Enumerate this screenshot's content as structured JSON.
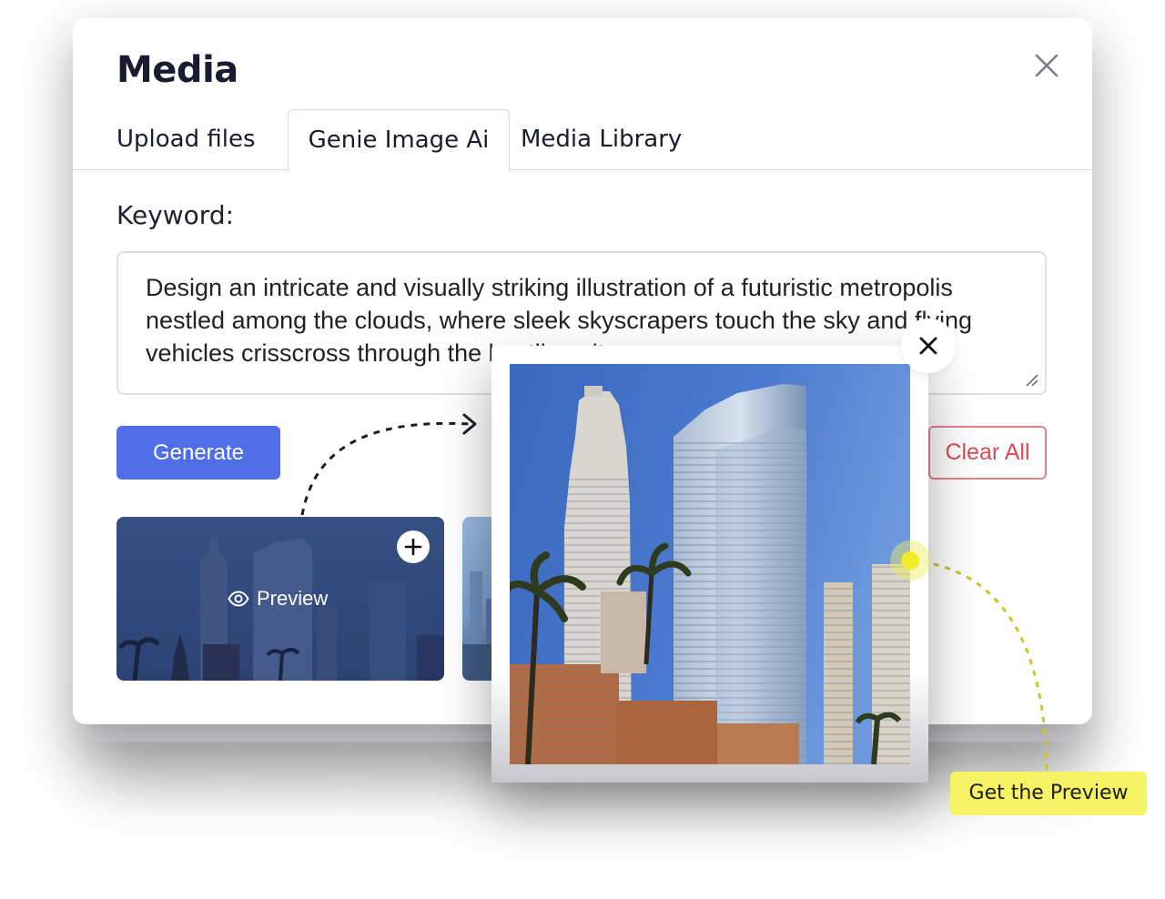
{
  "modal": {
    "title": "Media",
    "tabs": [
      {
        "label": "Upload files"
      },
      {
        "label": "Genie Image Ai",
        "active": true
      },
      {
        "label": "Media Library"
      }
    ]
  },
  "form": {
    "keyword_label": "Keyword:",
    "keyword_value": "Design an intricate and visually striking illustration of a futuristic metropolis nestled among the clouds, where sleek skyscrapers touch the sky and flying vehicles crisscross through the bustling city.",
    "generate_label": "Generate",
    "clear_label": "Clear All"
  },
  "thumbnails": [
    {
      "preview_label": "Preview",
      "add_icon": "plus-icon",
      "view_icon": "eye-icon"
    }
  ],
  "callout": {
    "label": "Get the Preview"
  },
  "colors": {
    "primary": "#4f6ee8",
    "danger": "#dc4b55",
    "callout": "#f5f263"
  }
}
